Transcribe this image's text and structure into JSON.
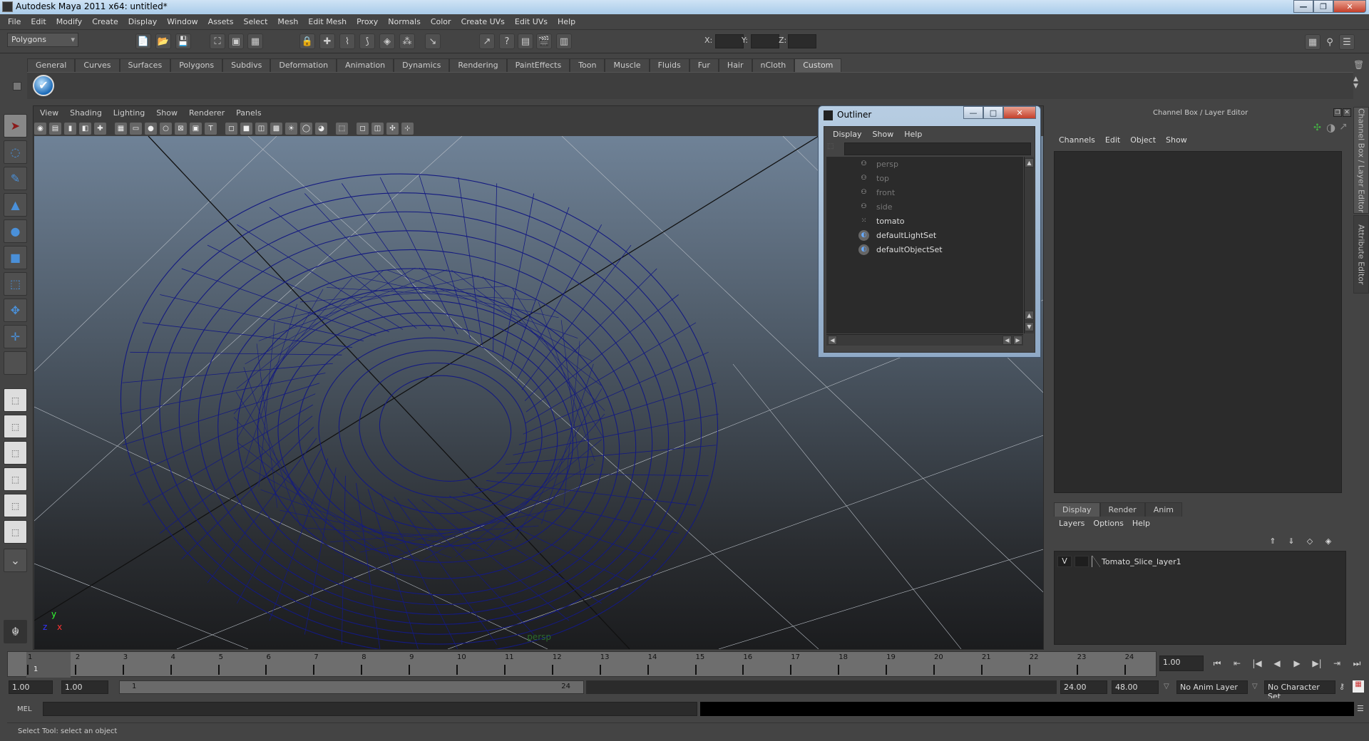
{
  "window": {
    "title": "Autodesk Maya 2011 x64: untitled*",
    "controls": [
      "minimize",
      "restore",
      "close"
    ]
  },
  "menubar": [
    "File",
    "Edit",
    "Modify",
    "Create",
    "Display",
    "Window",
    "Assets",
    "Select",
    "Mesh",
    "Edit Mesh",
    "Proxy",
    "Normals",
    "Color",
    "Create UVs",
    "Edit UVs",
    "Help"
  ],
  "statusline": {
    "menu_set": "Polygons",
    "coord_labels": {
      "x": "X:",
      "y": "Y:",
      "z": "Z:"
    },
    "x_value": "",
    "y_value": "",
    "z_value": "",
    "icons": [
      "new-scene-icon",
      "open-scene-icon",
      "save-scene-icon",
      "select-hierarchy-icon",
      "select-object-icon",
      "select-component-icon",
      "lock-selection-icon",
      "snap-grid-icon",
      "snap-curve-icon",
      "snap-point-icon",
      "snap-view-plane-icon",
      "snap-live-icon",
      "input-ops-icon",
      "output-ops-icon",
      "history-icon",
      "render-view-icon",
      "render-frame-icon",
      "ipr-render-icon",
      "render-settings-icon",
      "show-hide-channel-box-icon",
      "show-attribute-editor-icon",
      "show-tool-settings-icon"
    ]
  },
  "shelf": {
    "tabs": [
      "General",
      "Curves",
      "Surfaces",
      "Polygons",
      "Subdivs",
      "Deformation",
      "Animation",
      "Dynamics",
      "Rendering",
      "PaintEffects",
      "Toon",
      "Muscle",
      "Fluids",
      "Fur",
      "Hair",
      "nCloth",
      "Custom"
    ],
    "active_tab": "Custom",
    "items": [
      {
        "icon": "checkmark-icon",
        "glyph": "✔"
      }
    ]
  },
  "toolbox": {
    "tools": [
      {
        "name": "select-tool",
        "glyph": "➤",
        "active": true
      },
      {
        "name": "lasso-tool",
        "glyph": "◌"
      },
      {
        "name": "paint-select-tool",
        "glyph": "✎"
      },
      {
        "name": "move-tool",
        "glyph": "▲"
      },
      {
        "name": "rotate-tool",
        "glyph": "●"
      },
      {
        "name": "scale-tool",
        "glyph": "■"
      },
      {
        "name": "universal-manipulator",
        "glyph": "⬚"
      },
      {
        "name": "soft-modification-tool",
        "glyph": "✥"
      },
      {
        "name": "show-manipulator-tool",
        "glyph": "✛"
      },
      {
        "name": "last-tool",
        "glyph": ""
      }
    ],
    "layouts": [
      "single-perspective-layout",
      "four-view-layout",
      "outliner-persp-layout",
      "persp-graph-layout",
      "hypershade-persp-layout",
      "persp-outliner-graph-layout"
    ]
  },
  "viewport": {
    "menu": [
      "View",
      "Shading",
      "Lighting",
      "Show",
      "Renderer",
      "Panels"
    ],
    "camera_label": "persp",
    "axis": {
      "x": "x",
      "y": "y",
      "z": "z"
    },
    "icon_count": 24
  },
  "outliner": {
    "title": "Outliner",
    "menu": [
      "Display",
      "Show",
      "Help"
    ],
    "filter": "",
    "items": [
      {
        "label": "persp",
        "type": "camera",
        "dim": true
      },
      {
        "label": "top",
        "type": "camera",
        "dim": true
      },
      {
        "label": "front",
        "type": "camera",
        "dim": true
      },
      {
        "label": "side",
        "type": "camera",
        "dim": true
      },
      {
        "label": "tomato",
        "type": "mesh",
        "dim": false
      },
      {
        "label": "defaultLightSet",
        "type": "set",
        "dim": false
      },
      {
        "label": "defaultObjectSet",
        "type": "set",
        "dim": false
      }
    ]
  },
  "channel_box": {
    "title": "Channel Box / Layer Editor",
    "menu": [
      "Channels",
      "Edit",
      "Object",
      "Show"
    ],
    "side_tabs": [
      "Channel Box / Layer Editor",
      "Attribute Editor"
    ]
  },
  "layer_editor": {
    "tabs": [
      "Display",
      "Render",
      "Anim"
    ],
    "active_tab": "Display",
    "menu": [
      "Layers",
      "Options",
      "Help"
    ],
    "layers": [
      {
        "visible": "V",
        "template": "",
        "name": "Tomato_Slice_layer1"
      }
    ]
  },
  "time_slider": {
    "ticks": [
      "1",
      "2",
      "3",
      "4",
      "5",
      "6",
      "7",
      "8",
      "9",
      "10",
      "11",
      "12",
      "13",
      "14",
      "15",
      "16",
      "17",
      "18",
      "19",
      "20",
      "21",
      "22",
      "23",
      "24"
    ],
    "current_frame": "1",
    "current_time_field": "1.00",
    "playback_buttons": [
      "go-to-start",
      "step-back-frame",
      "step-back-key",
      "play-backwards",
      "play-forwards",
      "step-forward-key",
      "step-forward-frame",
      "go-to-end"
    ]
  },
  "range_slider": {
    "start_time": "1.00",
    "playback_start": "1.00",
    "range_start_label": "1",
    "range_end_label": "24",
    "playback_end": "24.00",
    "end_time": "48.00",
    "anim_layer": "No Anim Layer",
    "character_set": "No Character Set"
  },
  "command_line": {
    "label": "MEL",
    "value": "",
    "result": ""
  },
  "help_line": "Select Tool: select an object"
}
